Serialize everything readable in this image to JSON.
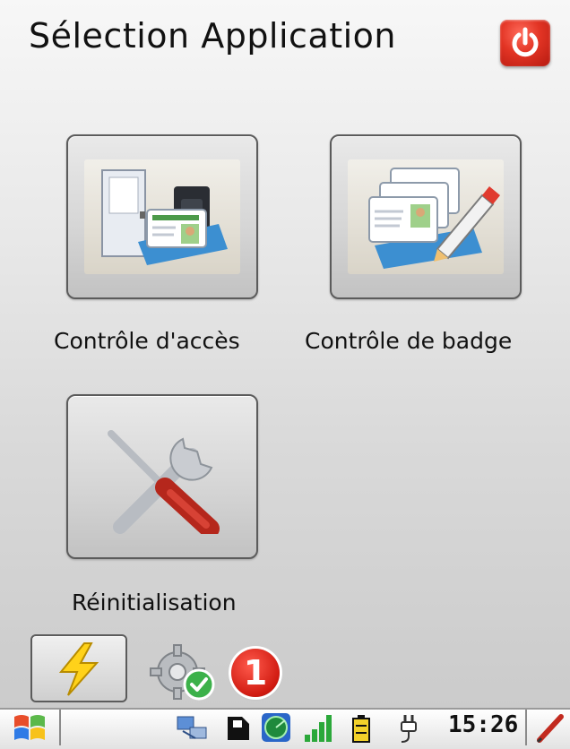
{
  "header": {
    "title": "Sélection Application",
    "power_icon": "power-icon"
  },
  "tiles": [
    {
      "label": "Contrôle d'accès",
      "icon": "access-control-icon"
    },
    {
      "label": "Contrôle de badge",
      "icon": "badge-control-icon"
    },
    {
      "label": "Réinitialisation",
      "icon": "tools-icon"
    }
  ],
  "bottom": {
    "flash_icon": "lightning-icon",
    "status_icon": "gear-check-icon",
    "notification_count": "1"
  },
  "taskbar": {
    "start_icon": "windows-flag-icon",
    "clock": "15:26",
    "icons": [
      "network-icon",
      "sd-card-icon",
      "radar-icon",
      "signal-icon",
      "battery-icon",
      "power-plug-icon",
      "pen-icon"
    ]
  },
  "colors": {
    "accent_red": "#e23424",
    "tile_border": "#5b5b5b"
  }
}
